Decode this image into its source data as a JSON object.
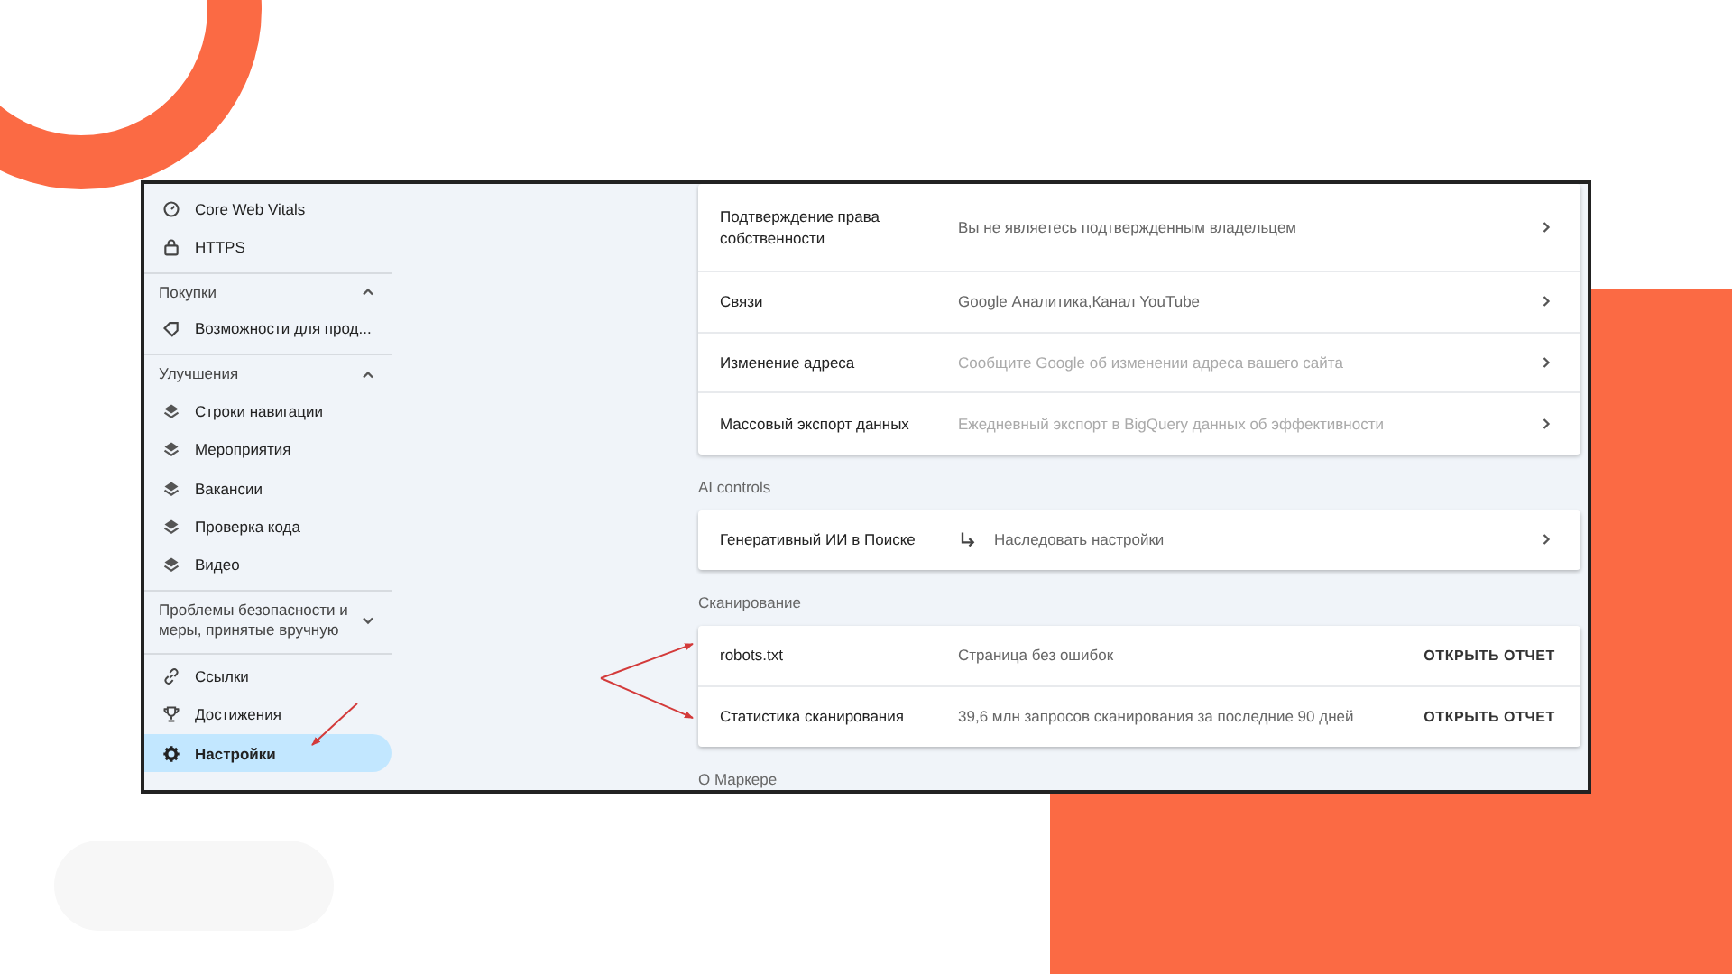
{
  "sidebar": {
    "sections": [
      {
        "items": [
          {
            "label": "Core Web Vitals",
            "selected": false
          },
          {
            "label": "HTTPS",
            "selected": false
          }
        ]
      },
      {
        "title": "Покупки",
        "expanded": true,
        "items": [
          {
            "label": "Возможности для прод...",
            "selected": false
          }
        ]
      },
      {
        "title": "Улучшения",
        "expanded": true,
        "items": [
          {
            "label": "Строки навигации",
            "selected": false
          },
          {
            "label": "Мероприятия",
            "selected": false
          },
          {
            "label": "Вакансии",
            "selected": false
          },
          {
            "label": "Проверка кода",
            "selected": false
          },
          {
            "label": "Видео",
            "selected": false
          }
        ]
      },
      {
        "title": "Проблемы безопасности и меры, принятые вручную",
        "expanded": false
      },
      {
        "items": [
          {
            "label": "Ссылки",
            "selected": false
          },
          {
            "label": "Достижения",
            "selected": false
          },
          {
            "label": "Настройки",
            "selected": true
          }
        ]
      }
    ]
  },
  "settings": {
    "groups": [
      {
        "rows": [
          {
            "kind": "link",
            "name": "Подтверждение права собственности",
            "value": "Вы не являетесь подтвержденным владельцем",
            "disabled": false
          },
          {
            "kind": "link",
            "name": "Связи",
            "value": "Google Аналитика,Канал YouTube",
            "disabled": false
          },
          {
            "kind": "link",
            "name": "Изменение адреса",
            "value": "Сообщите Google об изменении адреса вашего сайта",
            "disabled": true
          },
          {
            "kind": "link",
            "name": "Массовый экспорт данных",
            "value": "Ежедневный экспорт в BigQuery данных об эффективности",
            "disabled": true
          }
        ]
      },
      {
        "title": "AI controls",
        "rows": [
          {
            "kind": "inherit",
            "name": "Генеративный ИИ в Поиске",
            "value": "Наследовать настройки",
            "disabled": false
          }
        ]
      },
      {
        "title": "Сканирование",
        "rows": [
          {
            "kind": "report",
            "name": "robots.txt",
            "value": "Страница без ошибок",
            "action": "ОТКРЫТЬ ОТЧЕТ",
            "disabled": false
          },
          {
            "kind": "report",
            "name": "Статистика сканирования",
            "value": "39,6 млн запросов сканирования за последние 90 дней",
            "action": "ОТКРЫТЬ ОТЧЕТ",
            "disabled": false
          }
        ]
      },
      {
        "title": "О Маркере"
      }
    ]
  }
}
